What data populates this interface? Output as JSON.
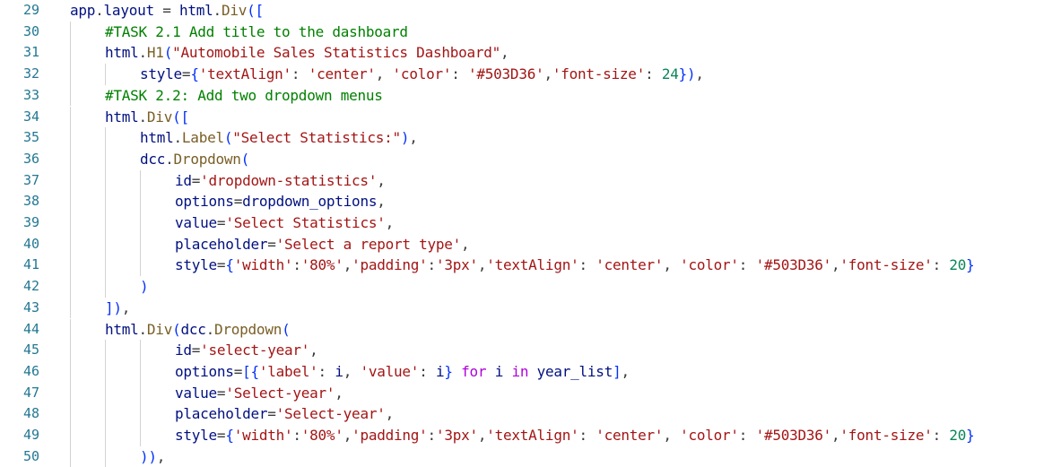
{
  "editor": {
    "language": "python",
    "lines": [
      {
        "num": "29",
        "indent": 0,
        "text": "app.layout = html.Div(["
      },
      {
        "num": "30",
        "indent": 1,
        "text": "#TASK 2.1 Add title to the dashboard"
      },
      {
        "num": "31",
        "indent": 1,
        "text": "html.H1(\"Automobile Sales Statistics Dashboard\","
      },
      {
        "num": "32",
        "indent": 2,
        "text": "style={'textAlign': 'center', 'color': '#503D36','font-size': 24}),"
      },
      {
        "num": "33",
        "indent": 1,
        "text": "#TASK 2.2: Add two dropdown menus"
      },
      {
        "num": "34",
        "indent": 1,
        "text": "html.Div(["
      },
      {
        "num": "35",
        "indent": 2,
        "text": "html.Label(\"Select Statistics:\"),"
      },
      {
        "num": "36",
        "indent": 2,
        "text": "dcc.Dropdown("
      },
      {
        "num": "37",
        "indent": 3,
        "text": "id='dropdown-statistics',"
      },
      {
        "num": "38",
        "indent": 3,
        "text": "options=dropdown_options,"
      },
      {
        "num": "39",
        "indent": 3,
        "text": "value='Select Statistics',"
      },
      {
        "num": "40",
        "indent": 3,
        "text": "placeholder='Select a report type',"
      },
      {
        "num": "41",
        "indent": 3,
        "text": "style={'width':'80%','padding':'3px','textAlign': 'center', 'color': '#503D36','font-size': 20}"
      },
      {
        "num": "42",
        "indent": 2,
        "text": ")"
      },
      {
        "num": "43",
        "indent": 1,
        "text": "]),"
      },
      {
        "num": "44",
        "indent": 1,
        "text": "html.Div(dcc.Dropdown("
      },
      {
        "num": "45",
        "indent": 3,
        "text": "id='select-year',"
      },
      {
        "num": "46",
        "indent": 3,
        "text": "options=[{'label': i, 'value': i} for i in year_list],"
      },
      {
        "num": "47",
        "indent": 3,
        "text": "value='Select-year',"
      },
      {
        "num": "48",
        "indent": 3,
        "text": "placeholder='Select-year',"
      },
      {
        "num": "49",
        "indent": 3,
        "text": "style={'width':'80%','padding':'3px','textAlign': 'center', 'color': '#503D36','font-size': 20}"
      },
      {
        "num": "50",
        "indent": 2,
        "text": ")),"
      }
    ]
  },
  "colors": {
    "line_number": "#237893",
    "string": "#a31515",
    "comment": "#008000",
    "number": "#098658",
    "keyword": "#af00db",
    "variable": "#001080",
    "function": "#795e26",
    "bracket": "#0431fa",
    "indent_guide": "#d3d3d3"
  }
}
